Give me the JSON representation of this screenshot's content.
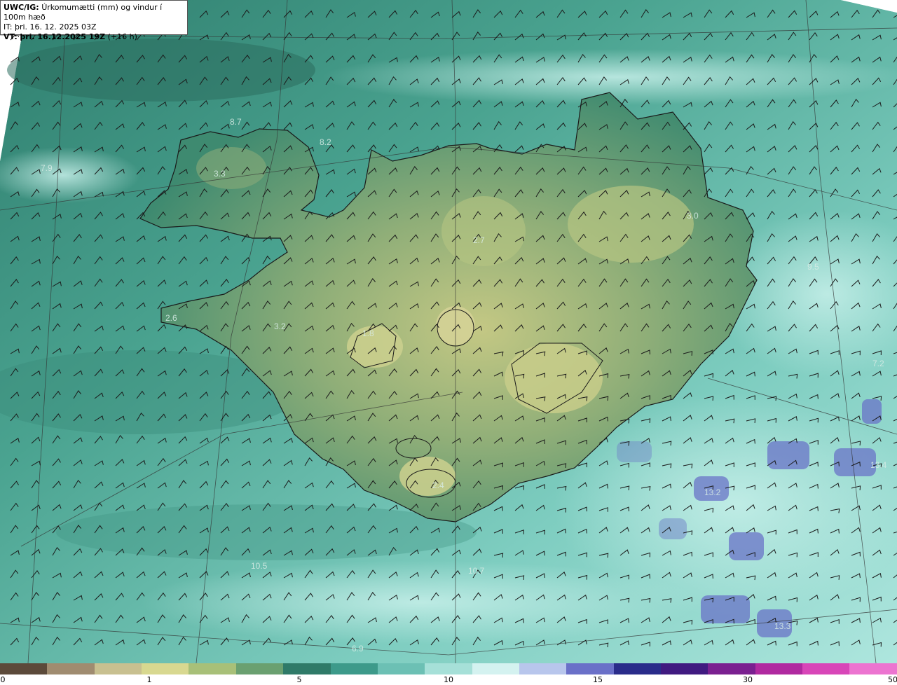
{
  "header": {
    "product": "UWC/IG:",
    "title": "Úrkomumætti (mm) og vindur í 100m hæð",
    "init_time": "IT: þri. 16. 12. 2025 03Z",
    "valid_prefix": "VT:",
    "valid_time": "þri. 16.12.2025 19Z",
    "lead": "(+16 h)"
  },
  "map_labels": [
    {
      "id": "w-79",
      "text": "7.9"
    },
    {
      "id": "w-33",
      "text": "3.3"
    },
    {
      "id": "w-82",
      "text": "8.2"
    },
    {
      "id": "w-87",
      "text": "8.7"
    },
    {
      "id": "w-27",
      "text": "2.7"
    },
    {
      "id": "w-30",
      "text": "3.0"
    },
    {
      "id": "w-95",
      "text": "9.5"
    },
    {
      "id": "w-26",
      "text": "2.6"
    },
    {
      "id": "w-32",
      "text": "3.2"
    },
    {
      "id": "w-18",
      "text": "1.8"
    },
    {
      "id": "w-72",
      "text": "7.2"
    },
    {
      "id": "w-24",
      "text": "2.4"
    },
    {
      "id": "w-105",
      "text": "10.5"
    },
    {
      "id": "w-107",
      "text": "10.7"
    },
    {
      "id": "w-132",
      "text": "13.2"
    },
    {
      "id": "w-134",
      "text": "13.4"
    },
    {
      "id": "w-133",
      "text": "13.3"
    },
    {
      "id": "w-69",
      "text": "6.9"
    }
  ],
  "colorbar": {
    "ticks": [
      "0",
      "1",
      "5",
      "10",
      "15",
      "30",
      "50"
    ],
    "colors": [
      "#5c4a3a",
      "#a08c70",
      "#c8c090",
      "#d8d890",
      "#a8c078",
      "#6aa070",
      "#2f7a68",
      "#3d9a8a",
      "#6cc0b4",
      "#a6e0d8",
      "#d4f2f0",
      "#b8c6ec",
      "#6a70c8",
      "#2a2c8a",
      "#401a80",
      "#7a2090",
      "#b02aa0",
      "#d846b8",
      "#ec74d0"
    ]
  },
  "colors": {
    "sea_dark": "#2f7e6e",
    "sea_light": "#a6e0d8",
    "land_low": "#3f8f74",
    "land_high": "#c8cc8a",
    "precip_blue": "#6a74c8"
  }
}
